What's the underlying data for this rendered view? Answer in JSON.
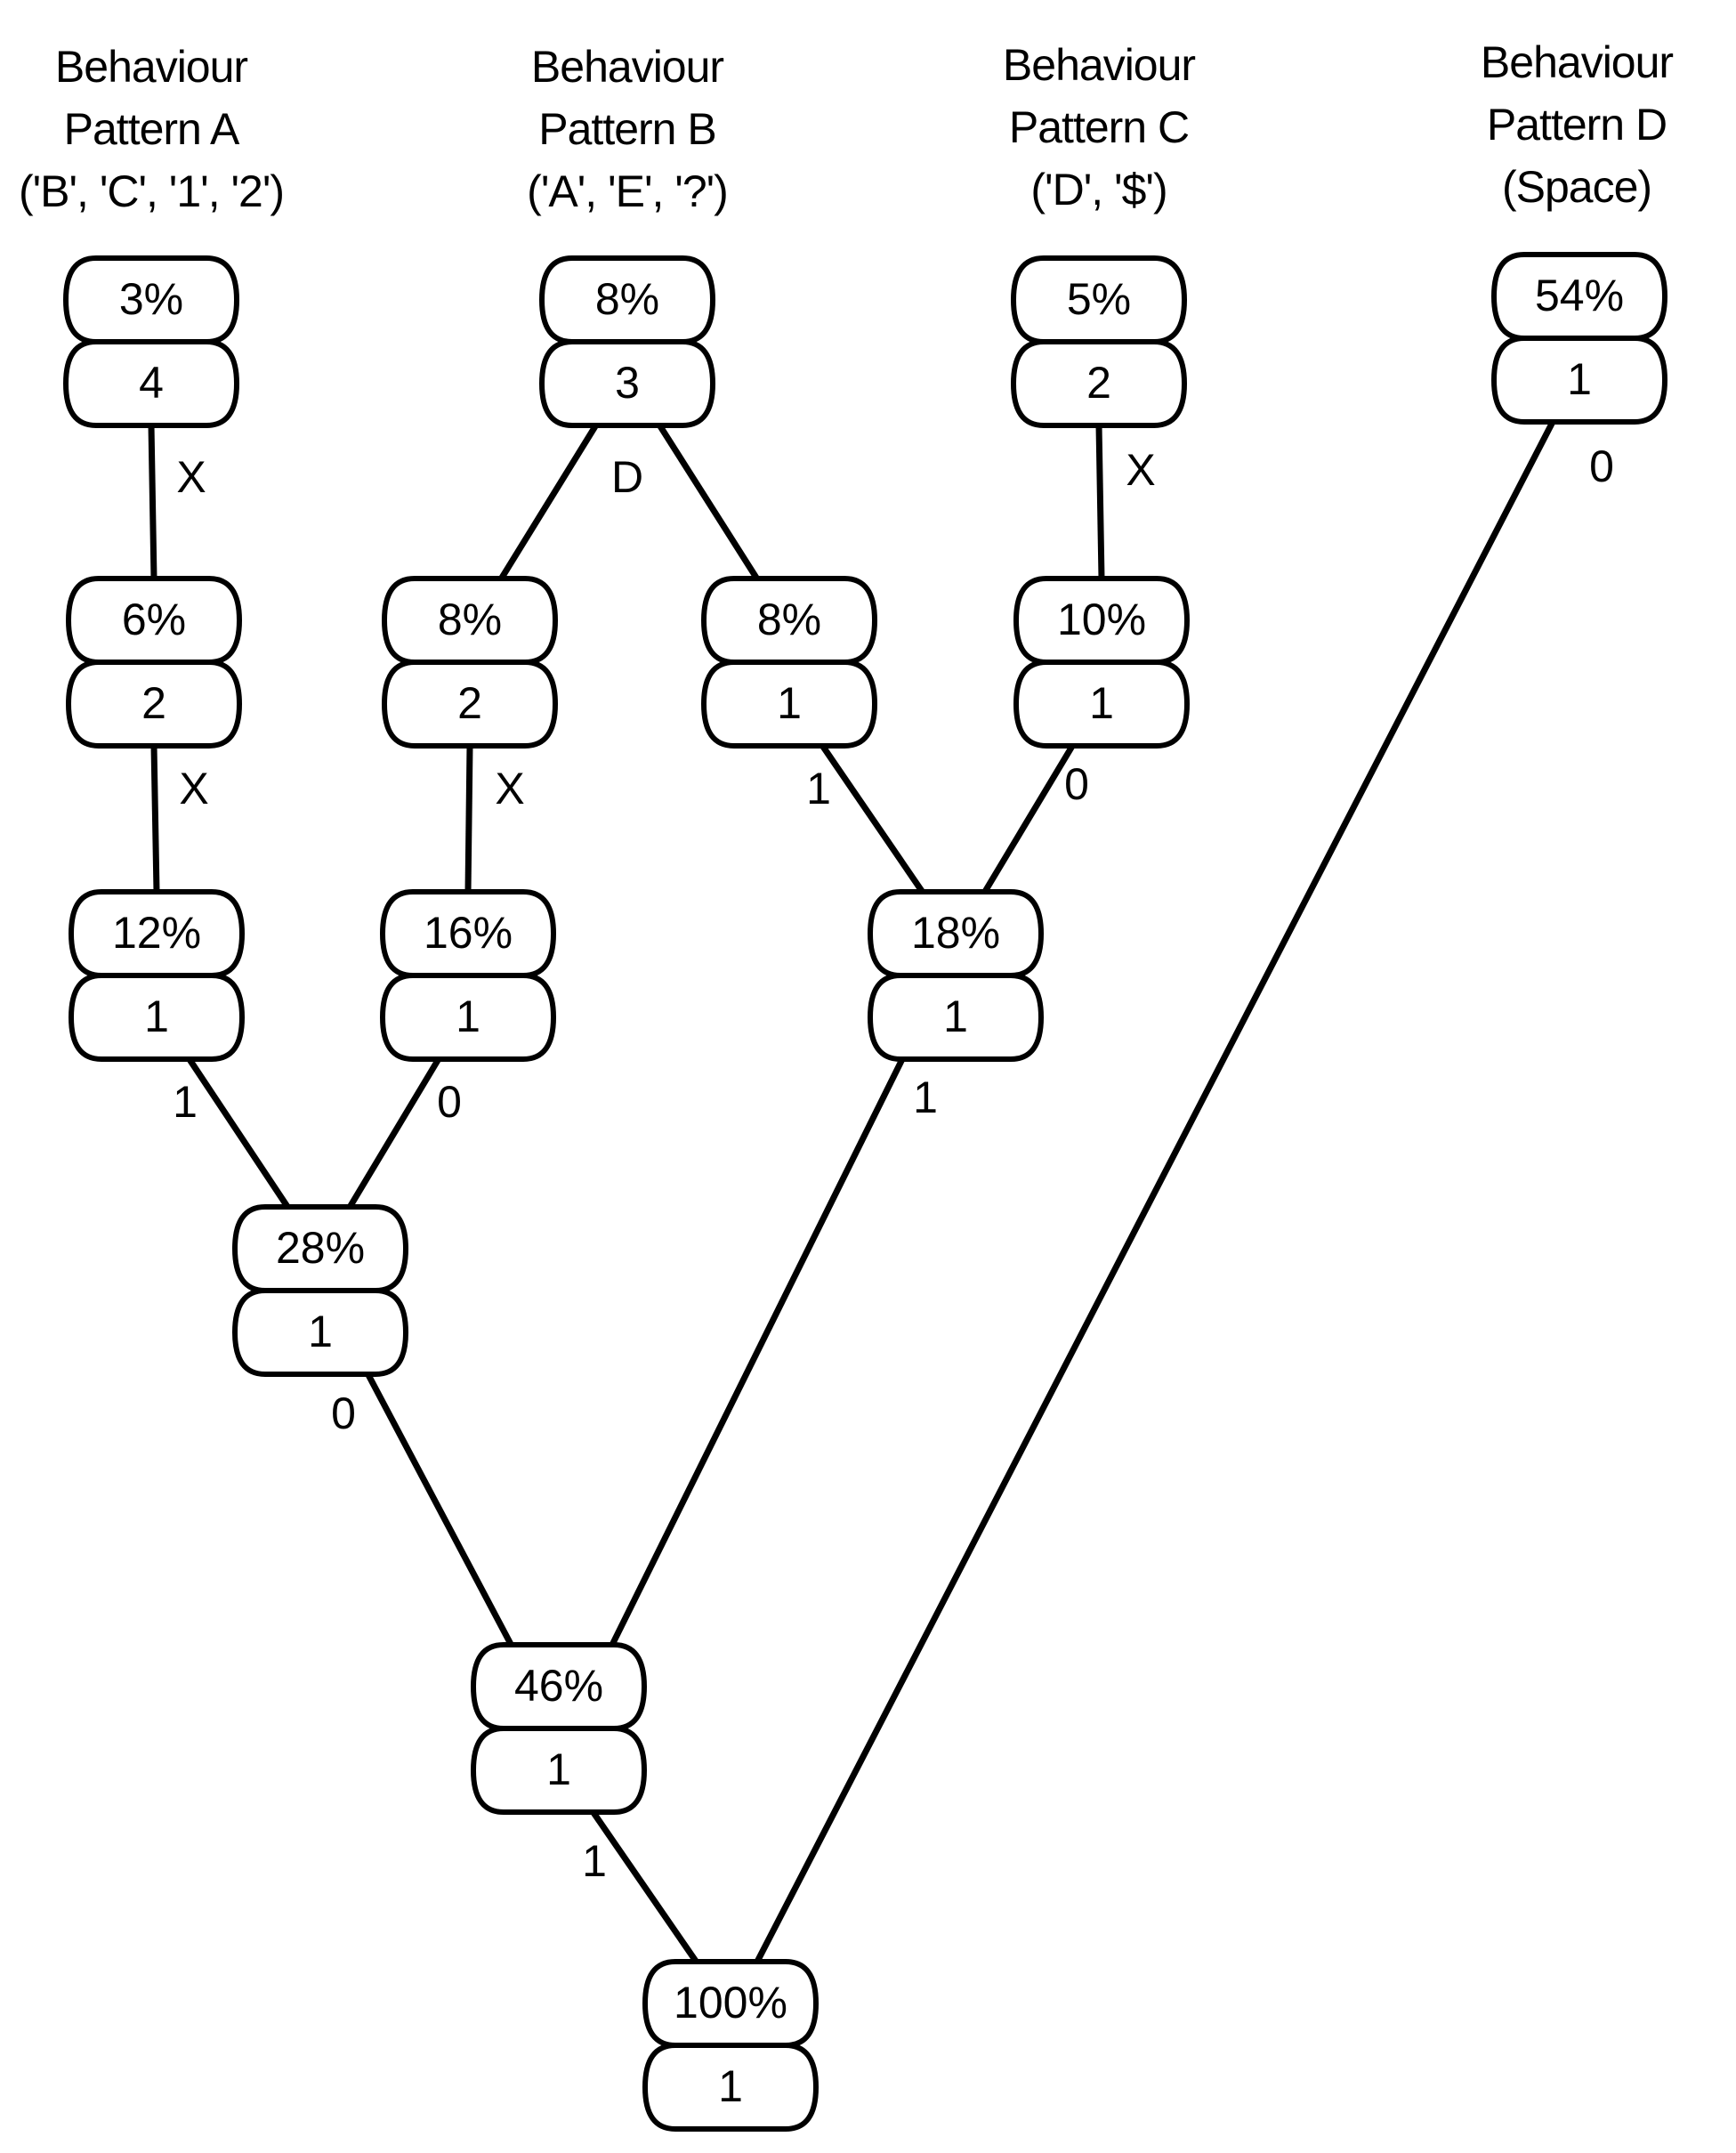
{
  "headers": [
    {
      "id": "A",
      "line1": "Behaviour",
      "line2": "Pattern A",
      "line3": "('B', 'C', '1', '2')"
    },
    {
      "id": "B",
      "line1": "Behaviour",
      "line2": "Pattern B",
      "line3": "('A', 'E', '?')"
    },
    {
      "id": "C",
      "line1": "Behaviour",
      "line2": "Pattern C",
      "line3": "('D', '$')"
    },
    {
      "id": "D",
      "line1": "Behaviour",
      "line2": "Pattern D",
      "line3": "(Space)"
    }
  ],
  "nodes": [
    {
      "id": "A1",
      "percent": "3%",
      "count": "4"
    },
    {
      "id": "B1",
      "percent": "8%",
      "count": "3"
    },
    {
      "id": "C1",
      "percent": "5%",
      "count": "2"
    },
    {
      "id": "D1",
      "percent": "54%",
      "count": "1"
    },
    {
      "id": "A2",
      "percent": "6%",
      "count": "2"
    },
    {
      "id": "B2L",
      "percent": "8%",
      "count": "2"
    },
    {
      "id": "B2R",
      "percent": "8%",
      "count": "1"
    },
    {
      "id": "C2",
      "percent": "10%",
      "count": "1"
    },
    {
      "id": "A3",
      "percent": "12%",
      "count": "1"
    },
    {
      "id": "B3",
      "percent": "16%",
      "count": "1"
    },
    {
      "id": "BC",
      "percent": "18%",
      "count": "1"
    },
    {
      "id": "AB",
      "percent": "28%",
      "count": "1"
    },
    {
      "id": "ABC",
      "percent": "46%",
      "count": "1"
    },
    {
      "id": "ROOT",
      "percent": "100%",
      "count": "1"
    }
  ],
  "edges": [
    {
      "from": "A1",
      "to": "A2",
      "label": "X"
    },
    {
      "from": "A2",
      "to": "A3",
      "label": "X"
    },
    {
      "from": "B1",
      "to": "B2L",
      "label": "D"
    },
    {
      "from": "B1",
      "to": "B2R",
      "label": ""
    },
    {
      "from": "B2L",
      "to": "B3",
      "label": "X"
    },
    {
      "from": "C1",
      "to": "C2",
      "label": "X"
    },
    {
      "from": "B2R",
      "to": "BC",
      "label": "1"
    },
    {
      "from": "C2",
      "to": "BC",
      "label": "0"
    },
    {
      "from": "A3",
      "to": "AB",
      "label": "1"
    },
    {
      "from": "B3",
      "to": "AB",
      "label": "0"
    },
    {
      "from": "AB",
      "to": "ABC",
      "label": "0"
    },
    {
      "from": "BC",
      "to": "ABC",
      "label": "1"
    },
    {
      "from": "ABC",
      "to": "ROOT",
      "label": "1"
    },
    {
      "from": "D1",
      "to": "ROOT",
      "label": "0"
    }
  ]
}
